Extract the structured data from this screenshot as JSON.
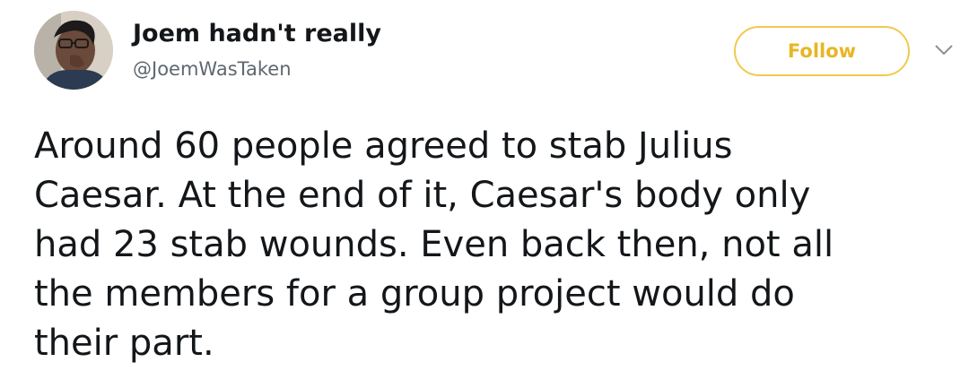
{
  "user": {
    "display_name": "Joem hadn't really",
    "handle": "@JoemWasTaken"
  },
  "actions": {
    "follow_label": "Follow",
    "menu_icon": "chevron-down-icon"
  },
  "tweet": {
    "lines": [
      "Around 60 people agreed to stab Julius",
      "Caesar. At the end of it, Caesar's body only",
      "had 23 stab wounds. Even back then, not all",
      "the members for a group project would do",
      "their part."
    ]
  },
  "colors": {
    "follow_accent": "#e8b624",
    "follow_border": "#f2c94c",
    "handle_gray": "#5f6770",
    "text": "#14171a"
  }
}
